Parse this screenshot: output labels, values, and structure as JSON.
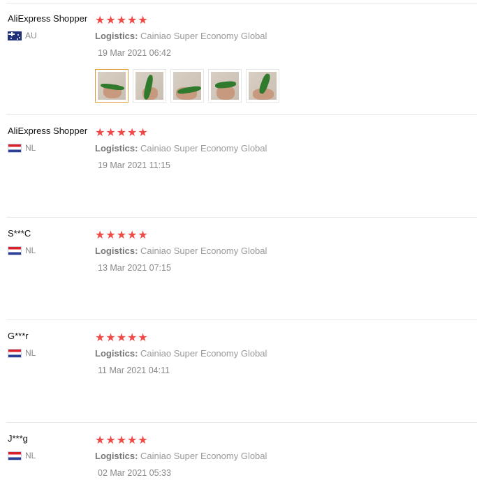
{
  "reviews": [
    {
      "user": "AliExpress Shopper",
      "country": "AU",
      "flag_icon": "au-flag-icon",
      "rating": 5,
      "logistics_label": "Logistics:",
      "logistics_value": "Cainiao Super Economy Global",
      "date": "19 Mar 2021 06:42",
      "photos": 5
    },
    {
      "user": "AliExpress Shopper",
      "country": "NL",
      "flag_icon": "nl-flag-icon",
      "rating": 5,
      "logistics_label": "Logistics:",
      "logistics_value": "Cainiao Super Economy Global",
      "date": "19 Mar 2021 11:15"
    },
    {
      "user": "S***C",
      "country": "NL",
      "flag_icon": "nl-flag-icon",
      "rating": 5,
      "logistics_label": "Logistics:",
      "logistics_value": "Cainiao Super Economy Global",
      "date": "13 Mar 2021 07:15"
    },
    {
      "user": "G***r",
      "country": "NL",
      "flag_icon": "nl-flag-icon",
      "rating": 5,
      "logistics_label": "Logistics:",
      "logistics_value": "Cainiao Super Economy Global",
      "date": "11 Mar 2021 04:11"
    },
    {
      "user": "J***g",
      "country": "NL",
      "flag_icon": "nl-flag-icon",
      "rating": 5,
      "logistics_label": "Logistics:",
      "logistics_value": "Cainiao Super Economy Global",
      "date": "02 Mar 2021 05:33"
    }
  ],
  "star_icon": "star-icon",
  "colors": {
    "star": "#f04a46",
    "selected_thumb_border": "#e39a3b",
    "divider": "#e8e8e8"
  }
}
